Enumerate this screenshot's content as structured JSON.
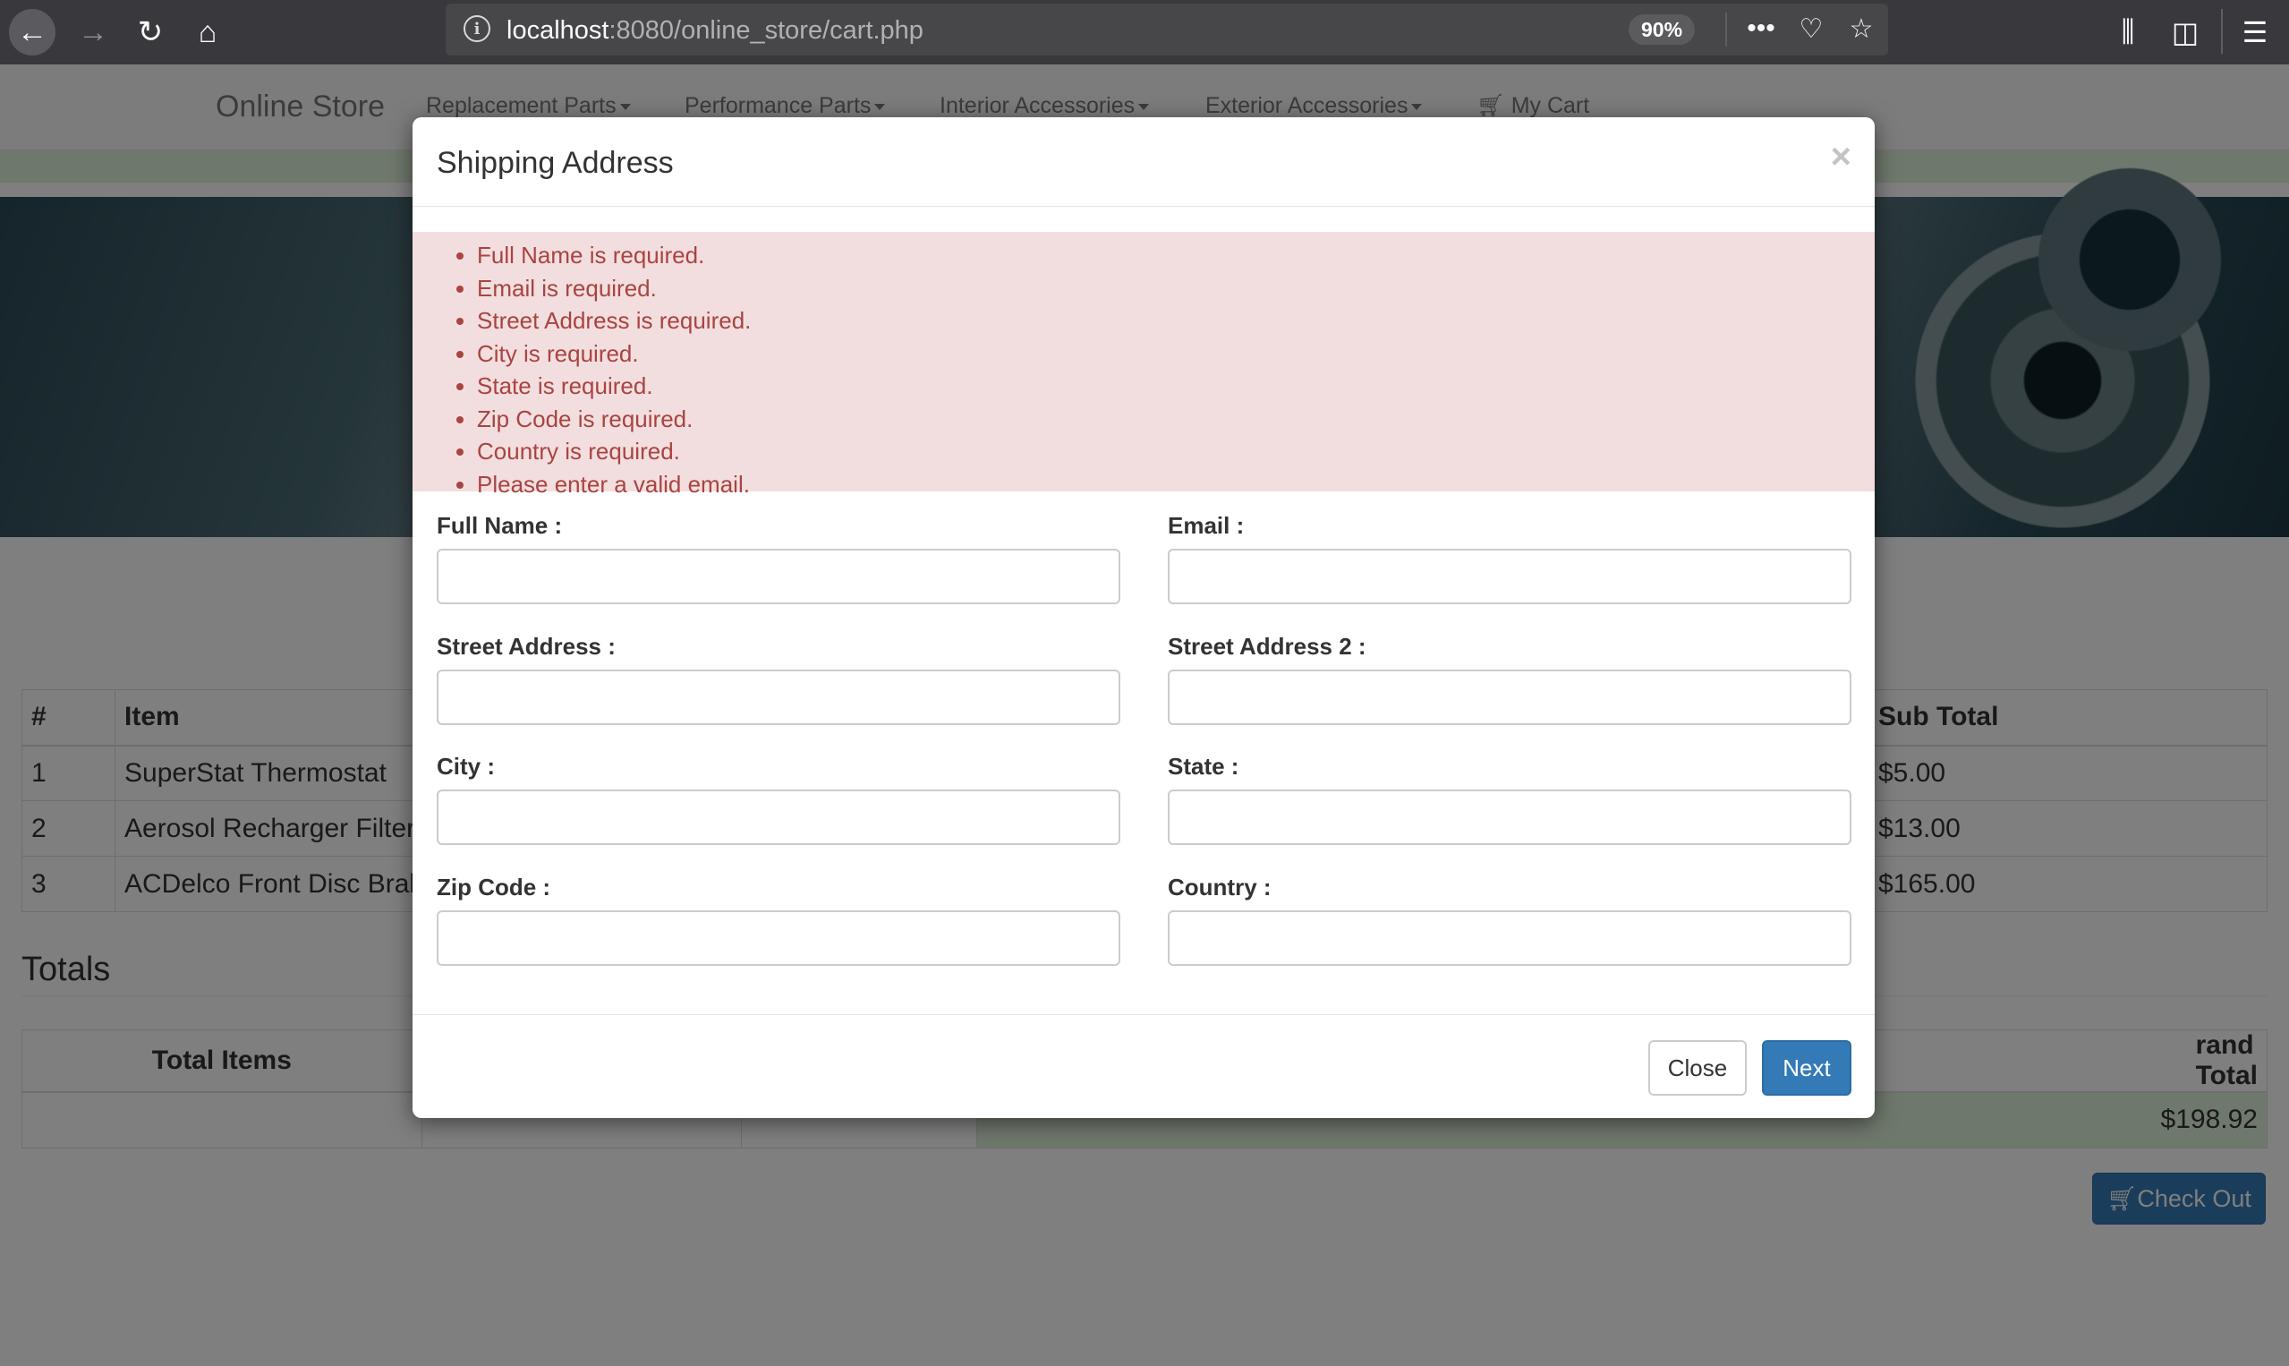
{
  "browser": {
    "url_host": "localhost",
    "url_path": ":8080/online_store/cart.php",
    "zoom": "90%"
  },
  "navbar": {
    "brand": "Online Store",
    "menus": [
      "Replacement Parts",
      "Performance Parts",
      "Interior Accessories",
      "Exterior Accessories"
    ],
    "cart_label": "My Cart"
  },
  "cart": {
    "headers": {
      "num": "#",
      "item": "Item",
      "subtotal": "Sub Total"
    },
    "rows": [
      {
        "num": "1",
        "item": "SuperStat Thermostat",
        "subtotal": "$5.00"
      },
      {
        "num": "2",
        "item": "Aerosol Recharger Filter",
        "subtotal": "$13.00"
      },
      {
        "num": "3",
        "item": "ACDelco Front Disc Brak",
        "subtotal": "$165.00"
      }
    ]
  },
  "totals": {
    "title": "Totals",
    "headers": {
      "total_items": "Total Items",
      "grand_total": "rand Total"
    },
    "grand_total_value": "$198.92"
  },
  "checkout_label": "Check Out",
  "modal": {
    "title": "Shipping Address",
    "close_x": "×",
    "errors": [
      "Full Name is required.",
      "Email is required.",
      "Street Address is required.",
      "City is required.",
      "State is required.",
      "Zip Code is required.",
      "Country is required.",
      "Please enter a valid email."
    ],
    "fields": {
      "full_name": {
        "label": "Full Name :",
        "value": ""
      },
      "email": {
        "label": "Email :",
        "value": ""
      },
      "street1": {
        "label": "Street Address :",
        "value": ""
      },
      "street2": {
        "label": "Street Address 2 :",
        "value": ""
      },
      "city": {
        "label": "City :",
        "value": ""
      },
      "state": {
        "label": "State :",
        "value": ""
      },
      "zip": {
        "label": "Zip Code :",
        "value": ""
      },
      "country": {
        "label": "Country :",
        "value": ""
      }
    },
    "close_button": "Close",
    "next_button": "Next"
  },
  "colors": {
    "primary": "#337ab7",
    "alert_bg": "#f2dede",
    "alert_text": "#a94442",
    "success_bg": "#dff0d8"
  }
}
